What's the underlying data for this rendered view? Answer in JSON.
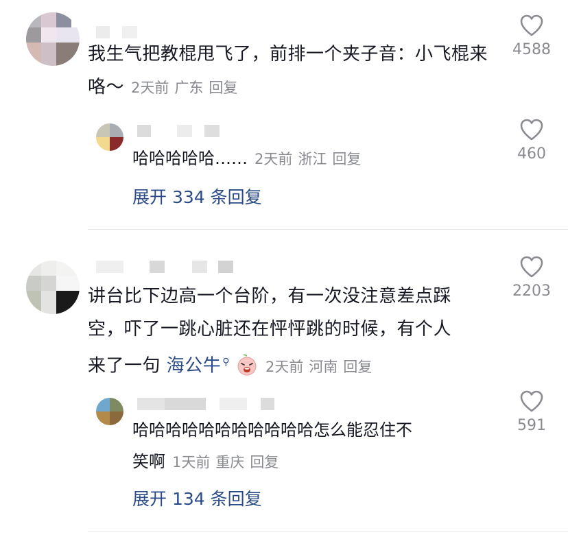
{
  "comments": [
    {
      "text": "我生气把教棍甩飞了，前排一个夹子音：小飞棍来咯～",
      "time": "2天前",
      "location": "广东",
      "reply_label": "回复",
      "likes": "4588",
      "replies": [
        {
          "text": "哈哈哈哈哈……",
          "time": "2天前",
          "location": "浙江",
          "reply_label": "回复",
          "likes": "460"
        }
      ],
      "expand_label": "展开 334 条回复"
    },
    {
      "text_lines": [
        "讲台比下边高一个台阶，有一次没注意差点踩",
        "空，吓了一跳心脏还在怦怦跳的时候，有个人",
        "来了一句 "
      ],
      "mention": "海公牛",
      "emoji": "peach-shocked-emoji",
      "time": "2天前",
      "location": "河南",
      "reply_label": "回复",
      "likes": "2203",
      "replies": [
        {
          "text_lines": [
            "哈哈哈哈哈哈哈哈哈哈哈怎么能忍住不",
            "笑啊"
          ],
          "time": "1天前",
          "location": "重庆",
          "reply_label": "回复",
          "likes": "591"
        }
      ],
      "expand_label": "展开 134 条回复"
    }
  ],
  "colors": {
    "text": "#161823",
    "meta": "#8a8b91",
    "link": "#2a4b87",
    "divider": "#e8e8ea"
  }
}
